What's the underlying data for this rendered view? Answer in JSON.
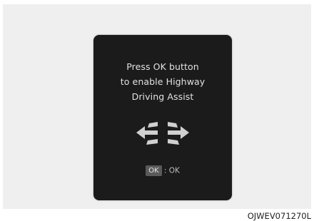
{
  "dialog": {
    "message_lines": [
      "Press OK button",
      "to enable Highway",
      "Driving Assist"
    ],
    "arrows_icon": "lane-change-arrows-icon",
    "ok_button_label": "OK",
    "ok_separator": ":",
    "ok_action_label": "OK"
  },
  "caption": "OJWEV071270L",
  "colors": {
    "background_panel": "#efefef",
    "screen": "#1b1b1b",
    "text": "#e2e2e2",
    "arrow": "#d0d0d0",
    "ok_button": "#5a5a5a"
  }
}
